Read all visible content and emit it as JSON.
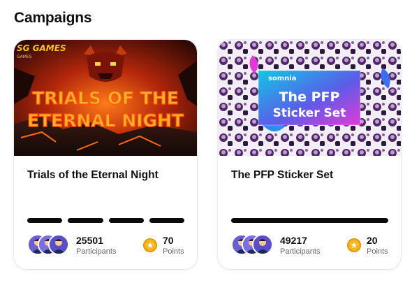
{
  "page": {
    "section_title": "Campaigns"
  },
  "campaigns": [
    {
      "banner_text": [
        "TRIALS OF THE",
        "ETERNAL NIGHT"
      ],
      "banner_logo": "SG GAMES",
      "title": "Trials of the Eternal Night",
      "progress_segments": 4,
      "participants_count": "25501",
      "participants_label": "Participants",
      "points_value": "70",
      "points_label": "Points"
    },
    {
      "banner_brand": "somnia",
      "banner_text": [
        "The PFP",
        "Sticker Set"
      ],
      "title": "The PFP Sticker Set",
      "progress_segments": 1,
      "participants_count": "49217",
      "participants_label": "Participants",
      "points_value": "20",
      "points_label": "Points"
    }
  ],
  "colors": {
    "accent_coin": "#f5b81c",
    "avatar_bg": "#6b5fd0",
    "progress": "#0a0a0a"
  }
}
